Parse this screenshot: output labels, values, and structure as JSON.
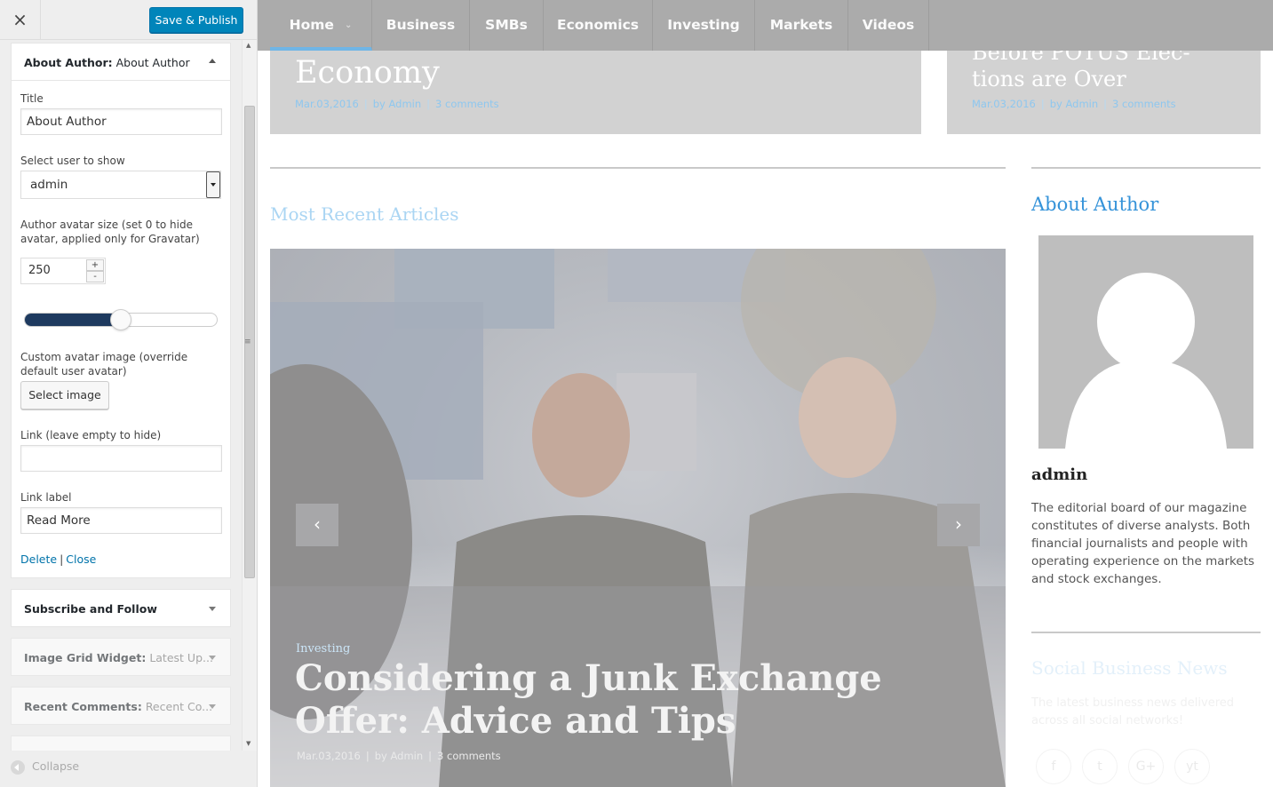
{
  "customizer": {
    "close_label": "×",
    "publish_label": "Save & Publish",
    "open_widget": {
      "title_prefix": "About Author:",
      "title_value": "About Author",
      "title_label": "Title",
      "title_input": "About Author",
      "user_label": "Select user to show",
      "user_value": "admin",
      "avatar_size_label": "Author avatar size (set 0 to hide avatar, applied only for Gravatar)",
      "avatar_size_value": "250",
      "avatar_size_level": 0.5,
      "custom_avatar_label": "Custom avatar image (override default user avatar)",
      "select_image_label": "Select image",
      "link_label": "Link (leave empty to hide)",
      "link_value": "",
      "link_label_label": "Link label",
      "link_label_value": "Read More",
      "delete_label": "Delete",
      "link_separator": "|",
      "close_link_label": "Close"
    },
    "widgets": [
      {
        "name": "Subscribe and Follow",
        "detail": ""
      },
      {
        "name": "Image Grid Widget:",
        "detail": "Latest Up..."
      },
      {
        "name": "Recent Comments:",
        "detail": "Recent Co..."
      }
    ],
    "collapse_label": "Collapse"
  },
  "preview": {
    "nav": [
      "Home",
      "Business",
      "SMBs",
      "Economics",
      "Investing",
      "Markets",
      "Videos"
    ],
    "card1": {
      "title": "Economy",
      "meta_date": "Mar.03,2016",
      "meta_by": "by",
      "meta_author": "Admin",
      "meta_comments": "3 comments"
    },
    "card2": {
      "title_line1": "Before POTUS Elec-",
      "title_line2": "tions are Over",
      "meta_date": "Mar.03,2016",
      "meta_by": "by",
      "meta_author": "Admin",
      "meta_comments": "3 comments"
    },
    "section_title": "Most Recent Articles",
    "slide": {
      "category": "Investing",
      "title": "Considering a Junk Exchange Offer: Advice and Tips",
      "meta_date": "Mar.03,2016",
      "meta_by": "by",
      "meta_author": "Admin",
      "meta_comments": "3 comments",
      "prev": "‹",
      "next": "›"
    },
    "about": {
      "title": "About Author",
      "name": "admin",
      "bio": "The editorial board of our magazine constitutes of diverse analysts. Both financial journalists and people with operating experience on the markets and stock exchanges."
    },
    "social": {
      "title": "Social Business News",
      "subtitle": "The latest business news delivered across all social networks!",
      "icons": [
        "f",
        "t",
        "G+",
        "yt"
      ]
    }
  }
}
